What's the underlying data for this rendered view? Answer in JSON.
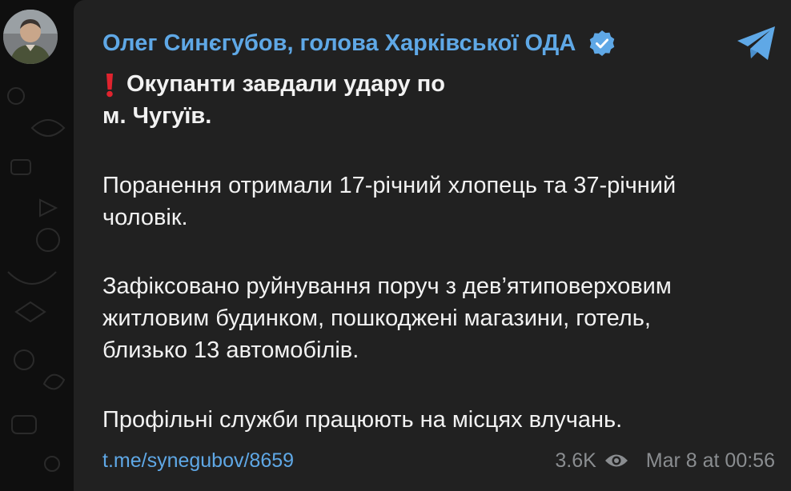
{
  "message": {
    "sender": "Олег Синєгубов, голова Харківської ОДА",
    "headline_line1": "Окупанти завдали удару по",
    "headline_line2": "м. Чугуїв.",
    "paragraph1_line1": "Поранення отримали 17-річний хлопець та 37-річний",
    "paragraph1_line2": "чоловік.",
    "paragraph2_line1": "Зафіксовано руйнування поруч з дев’ятиповерховим",
    "paragraph2_line2": "житловим будинком, пошкоджені магазини, готель,",
    "paragraph2_line3": "близько 13 автомобілів.",
    "paragraph3": "Профільні служби працюють на місцях влучань.",
    "link": "t.me/synegubov/8659",
    "views": "3.6K",
    "timestamp": "Mar 8 at 00:56"
  },
  "icons": {
    "verified": "verified-badge-icon",
    "share": "telegram-share-icon",
    "views": "eye-icon",
    "exclamation": "red-exclamation-icon"
  },
  "colors": {
    "accent": "#5fa8e6",
    "bubble": "#212121",
    "background": "#0f0f0f",
    "text": "#f2f2f2",
    "meta": "#8a8d90",
    "exclamation": "#e0232e"
  }
}
